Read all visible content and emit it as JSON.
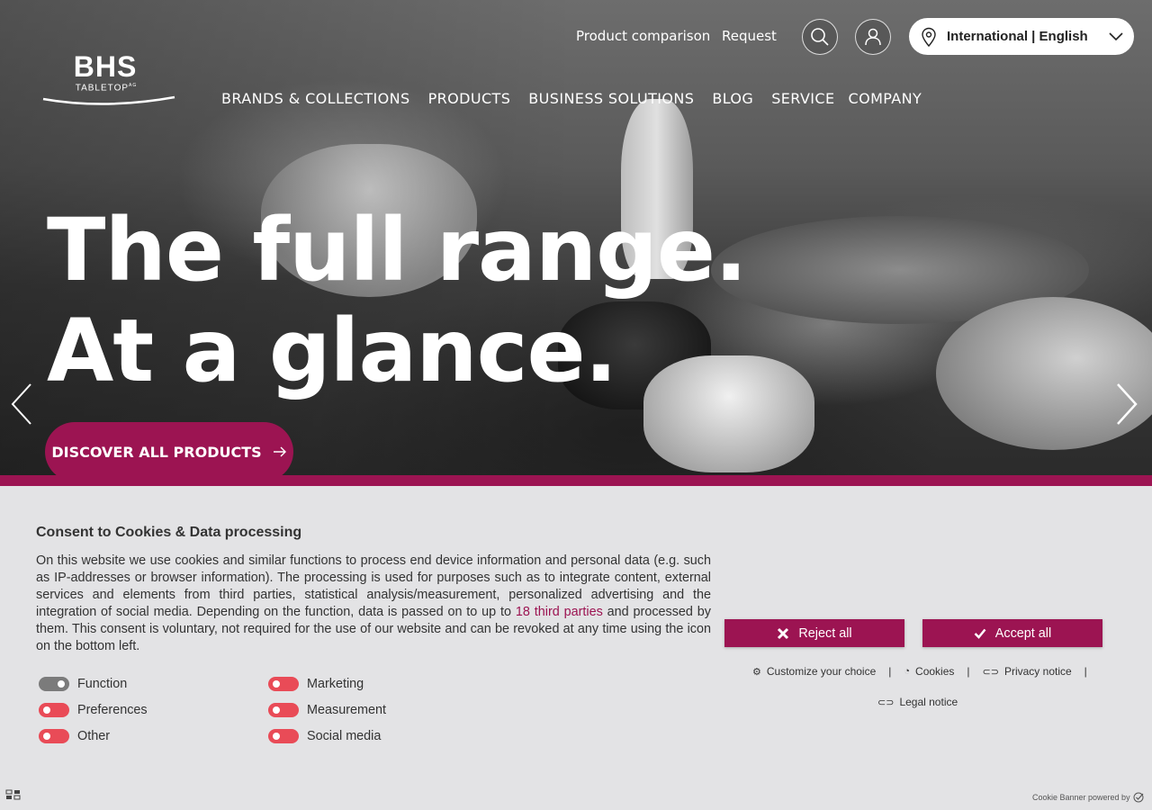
{
  "header": {
    "top_links": [
      "Product comparison",
      "Request"
    ],
    "language": "International | English",
    "logo": {
      "main": "BHS",
      "sub": "TABLETOP",
      "suffix": "AG"
    },
    "nav": [
      "BRANDS & COLLECTIONS",
      "PRODUCTS",
      "BUSINESS SOLUTIONS",
      "BLOG",
      "SERVICE",
      "COMPANY"
    ]
  },
  "hero": {
    "line1": "The full range.",
    "line2": "At a glance.",
    "cta": "DISCOVER ALL PRODUCTS"
  },
  "cookie": {
    "title": "Consent to Cookies & Data processing",
    "text_before": "On this website we use cookies and similar functions to process end device information and personal data (e.g. such as IP-addresses or browser information). The processing is used for purposes such as to integrate content, external services and elements from third parties, statistical analysis/measurement, personalized advertising and the integration of social media. Depending on the function, data is passed on to up to ",
    "text_link": "18 third parties",
    "text_after": " and processed by them. This consent is voluntary, not required for the use of our website and can be revoked at any time using the icon on the bottom left.",
    "toggles": [
      {
        "label": "Function",
        "on": true
      },
      {
        "label": "Marketing",
        "on": false
      },
      {
        "label": "Preferences",
        "on": false
      },
      {
        "label": "Measurement",
        "on": false
      },
      {
        "label": "Other",
        "on": false
      },
      {
        "label": "Social media",
        "on": false
      }
    ],
    "reject": "Reject all",
    "accept": "Accept all",
    "links": [
      "Customize your choice",
      "Cookies",
      "Privacy notice",
      "Legal notice"
    ],
    "powered_by": "Cookie Banner powered by"
  },
  "colors": {
    "accent": "#9c1452",
    "toggle_off": "#e94b57",
    "toggle_on": "#7b7b7b"
  }
}
